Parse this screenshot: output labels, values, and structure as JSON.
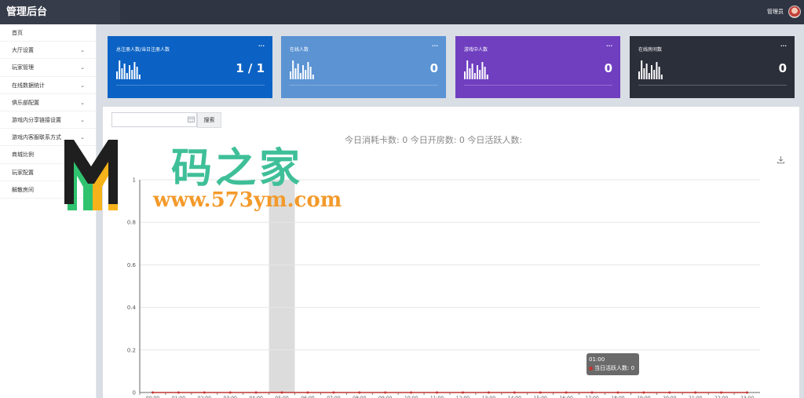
{
  "app": {
    "title": "管理后台",
    "user_label": "管理员"
  },
  "sidebar": {
    "items": [
      {
        "label": "首页",
        "expandable": false
      },
      {
        "label": "大厅设置",
        "expandable": true
      },
      {
        "label": "玩家管理",
        "expandable": true
      },
      {
        "label": "在线数据统计",
        "expandable": true
      },
      {
        "label": "俱乐部配置",
        "expandable": true
      },
      {
        "label": "游戏内分享链接设置",
        "expandable": true
      },
      {
        "label": "游戏内客服联系方式",
        "expandable": true
      },
      {
        "label": "商城比例",
        "expandable": false
      },
      {
        "label": "玩家配置",
        "expandable": false
      },
      {
        "label": "解散房间",
        "expandable": false
      }
    ]
  },
  "cards": [
    {
      "label": "总注册人数/当日注册人数",
      "value": "1 / 1",
      "more": "···",
      "color": "#0b62c4"
    },
    {
      "label": "在线人数",
      "value": "0",
      "more": "···",
      "color": "#5b93d3"
    },
    {
      "label": "游戏中人数",
      "value": "0",
      "more": "···",
      "color": "#6f3fc0"
    },
    {
      "label": "在线房间数",
      "value": "0",
      "more": "···",
      "color": "#2b2f3a"
    }
  ],
  "search": {
    "button_label": "搜索",
    "value": ""
  },
  "summary": "今日消耗卡数: 0   今日开房数: 0   今日活跃人数:",
  "watermark": {
    "text": "码之家",
    "url": "www.573ym.com"
  },
  "tooltip": {
    "time": "01:00",
    "series_label": "当日活跃人数: 0"
  },
  "chart_data": {
    "type": "line",
    "x": [
      "00:00",
      "01:00",
      "02:00",
      "03:00",
      "04:00",
      "05:00",
      "06:00",
      "07:00",
      "08:00",
      "09:00",
      "10:00",
      "11:00",
      "12:00",
      "13:00",
      "14:00",
      "15:00",
      "16:00",
      "17:00",
      "18:00",
      "19:00",
      "20:00",
      "21:00",
      "22:00",
      "23:00"
    ],
    "series": [
      {
        "values": [
          0,
          0,
          0,
          0,
          0,
          0,
          0,
          0,
          0,
          0,
          0,
          0,
          0,
          0,
          0,
          0,
          0,
          0,
          0,
          0,
          0,
          0,
          0,
          0
        ]
      }
    ],
    "ylim": [
      0,
      1
    ],
    "yticks": [
      "0",
      "0.2",
      "0.4",
      "0.6",
      "0.8",
      "1"
    ],
    "highlight_category": "05:00",
    "grid": true,
    "colors": {
      "series": "#c23531",
      "highlight": "#dcdcdc"
    }
  }
}
